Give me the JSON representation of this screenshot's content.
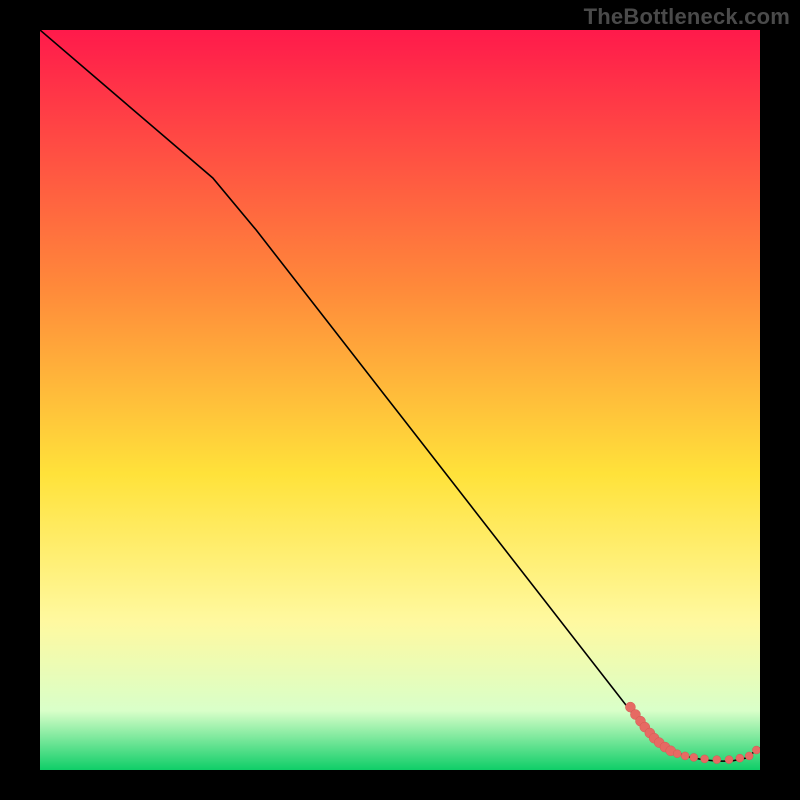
{
  "attribution": "TheBottleneck.com",
  "colors": {
    "line": "#000000",
    "scatter_fill": "#e66a63",
    "scatter_stroke": "#d35b54",
    "gradient_top": "#ff1a4b",
    "gradient_mid_upper": "#ff8a3a",
    "gradient_mid": "#ffe23a",
    "gradient_mid_lower": "#fff9a0",
    "gradient_lower": "#d9ffc9",
    "gradient_bottom": "#0fce68",
    "frame": "#000000"
  },
  "chart_data": {
    "type": "line",
    "title": "",
    "xlabel": "",
    "ylabel": "",
    "xlim": [
      0,
      100
    ],
    "ylim": [
      0,
      100
    ],
    "series": [
      {
        "name": "curve",
        "x": [
          0,
          12,
          24,
          30,
          40,
          50,
          60,
          70,
          80,
          84,
          88,
          90,
          92,
          94,
          96,
          98,
          100
        ],
        "y": [
          100,
          90,
          80,
          73,
          60.5,
          48,
          35.5,
          23,
          10.5,
          5.5,
          2.5,
          1.8,
          1.4,
          1.2,
          1.2,
          1.6,
          3.0
        ]
      }
    ],
    "scatter": {
      "name": "cluster",
      "points": [
        {
          "x": 82.0,
          "y": 8.5,
          "r": 5
        },
        {
          "x": 82.7,
          "y": 7.5,
          "r": 5
        },
        {
          "x": 83.4,
          "y": 6.6,
          "r": 5
        },
        {
          "x": 84.0,
          "y": 5.8,
          "r": 5
        },
        {
          "x": 84.7,
          "y": 5.0,
          "r": 5
        },
        {
          "x": 85.3,
          "y": 4.3,
          "r": 5
        },
        {
          "x": 86.0,
          "y": 3.7,
          "r": 5
        },
        {
          "x": 86.8,
          "y": 3.1,
          "r": 5
        },
        {
          "x": 87.6,
          "y": 2.6,
          "r": 5
        },
        {
          "x": 88.5,
          "y": 2.2,
          "r": 4
        },
        {
          "x": 89.6,
          "y": 1.9,
          "r": 4
        },
        {
          "x": 90.8,
          "y": 1.7,
          "r": 4
        },
        {
          "x": 92.3,
          "y": 1.5,
          "r": 4
        },
        {
          "x": 94.0,
          "y": 1.4,
          "r": 4
        },
        {
          "x": 95.7,
          "y": 1.4,
          "r": 4
        },
        {
          "x": 97.2,
          "y": 1.6,
          "r": 4
        },
        {
          "x": 98.5,
          "y": 1.9,
          "r": 4
        },
        {
          "x": 99.5,
          "y": 2.7,
          "r": 4
        }
      ]
    }
  }
}
